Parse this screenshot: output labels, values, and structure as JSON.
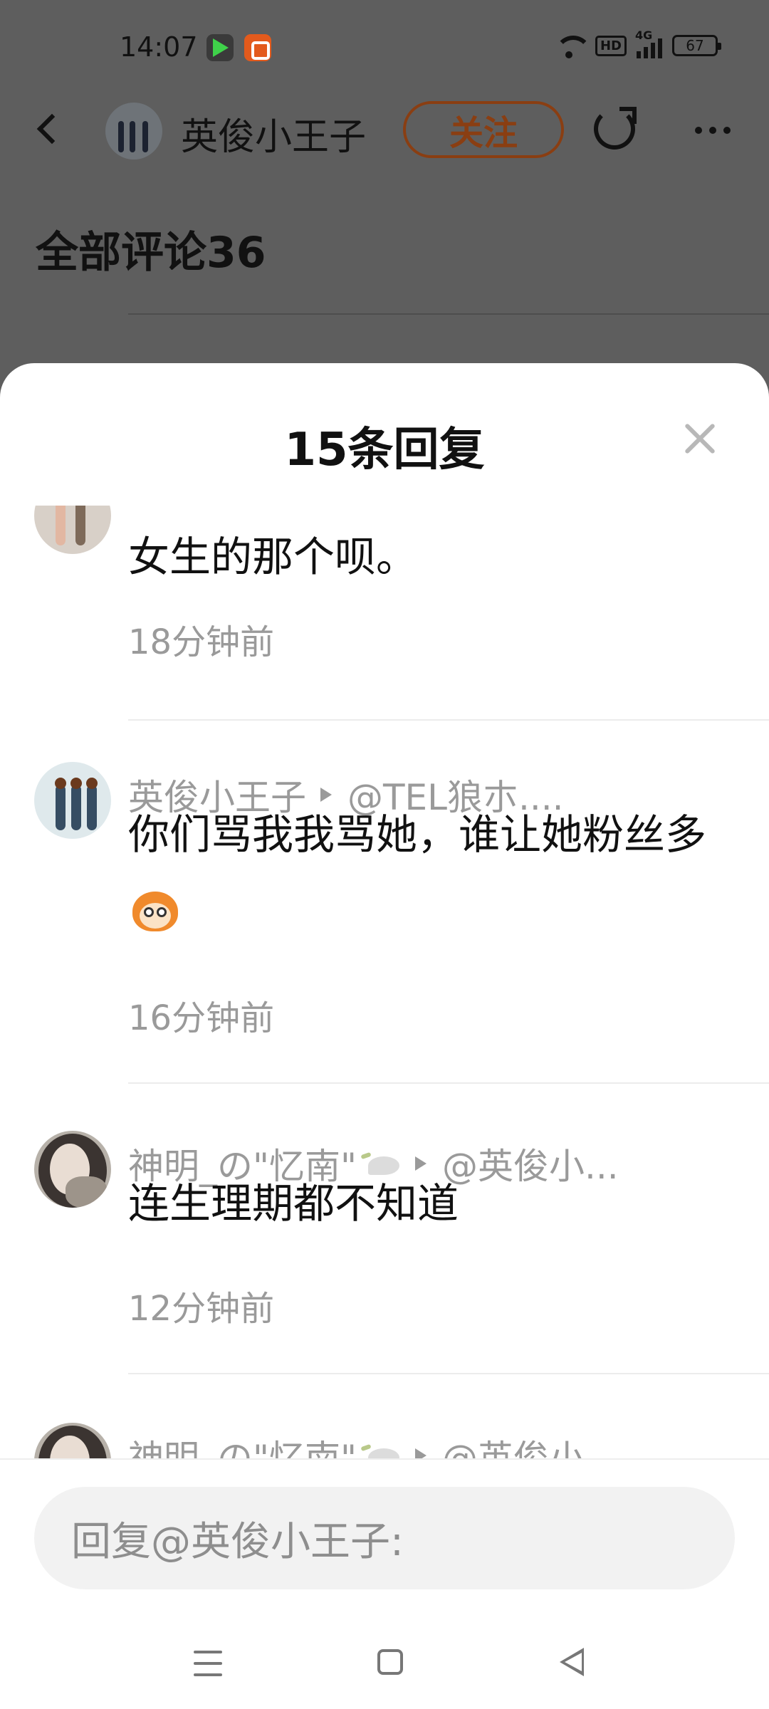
{
  "status_bar": {
    "time": "14:07",
    "hd_label": "HD",
    "network_label": "4G",
    "battery": "67"
  },
  "topbar": {
    "username": "英俊小王子",
    "follow_label": "关注"
  },
  "background": {
    "section_title": "全部评论36"
  },
  "sheet": {
    "title": "15条回复",
    "replies": [
      {
        "author": "",
        "target": "",
        "text": "女生的那个呗。",
        "time": "18分钟前"
      },
      {
        "author": "英俊小王子",
        "target": "@TEL狼朩....",
        "text": "你们骂我我骂她，谁让她粉丝多",
        "emoji": "monkey-emoji",
        "time": "16分钟前"
      },
      {
        "author": "神明_の\"忆南\"",
        "target": "@英俊小...",
        "text": "连生理期都不知道",
        "time": "12分钟前"
      },
      {
        "author": "神明_の\"忆南\"",
        "target": "@英俊小",
        "text": "",
        "time": ""
      }
    ]
  },
  "reply_box": {
    "placeholder": "回复@英俊小王子:"
  },
  "colors": {
    "overlay": "#5e5e5e",
    "follow": "#8a3e12",
    "muted_text": "#9a9a9a",
    "sheet_bg": "#ffffff"
  }
}
